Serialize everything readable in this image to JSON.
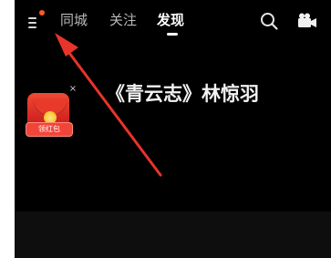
{
  "header": {
    "tabs": [
      {
        "label": "同城",
        "active": false
      },
      {
        "label": "关注",
        "active": false
      },
      {
        "label": "发现",
        "active": true
      }
    ],
    "menu_has_notification": true,
    "accent_dot_color": "#ff5a1f"
  },
  "main": {
    "headline": "《青云志》林惊羽"
  },
  "promo": {
    "label": "领红包",
    "close_symbol": "×"
  },
  "annotation": {
    "color": "#e8342a"
  },
  "icons": [
    "menu-icon",
    "search-icon",
    "camera-icon",
    "red-packet-icon",
    "close-icon"
  ]
}
